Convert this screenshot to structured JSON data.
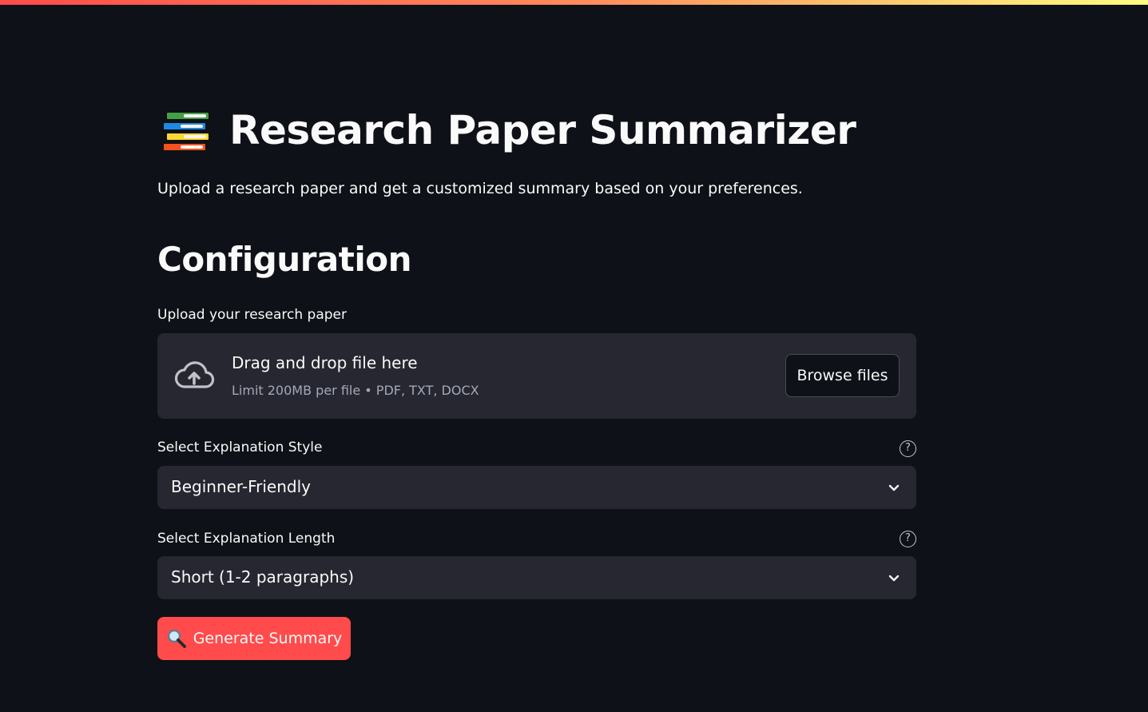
{
  "app": {
    "title": "Research Paper Summarizer",
    "title_icon": "books-icon",
    "subtitle": "Upload a research paper and get a customized summary based on your preferences."
  },
  "config": {
    "heading": "Configuration",
    "uploader": {
      "label": "Upload your research paper",
      "drag_text": "Drag and drop file here",
      "limit_text": "Limit 200MB per file • PDF, TXT, DOCX",
      "browse_label": "Browse files",
      "icon": "cloud-upload-icon"
    },
    "style_select": {
      "label": "Select Explanation Style",
      "value": "Beginner-Friendly",
      "help_icon": "help-icon"
    },
    "length_select": {
      "label": "Select Explanation Length",
      "value": "Short (1-2 paragraphs)",
      "help_icon": "help-icon"
    },
    "generate": {
      "label": "Generate Summary",
      "icon": "magnifier-icon"
    }
  },
  "colors": {
    "background": "#0e1117",
    "panel": "#262730",
    "primary": "#ff4b4b",
    "text": "#fafafa",
    "muted": "#a3a8b8"
  }
}
